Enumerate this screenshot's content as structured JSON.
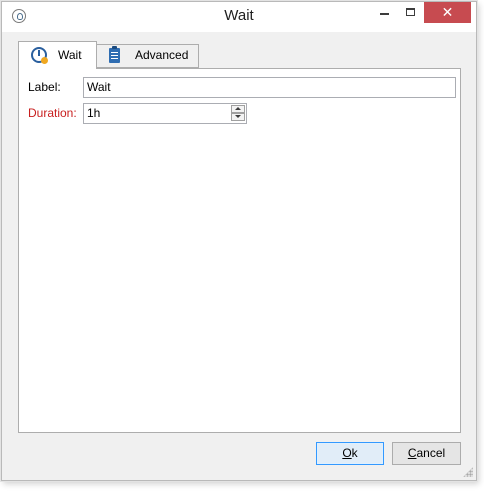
{
  "window": {
    "title": "Wait"
  },
  "titlebar": {
    "close_glyph": "✕"
  },
  "tabs": [
    {
      "label": "Wait",
      "icon": "clock-icon",
      "active": true
    },
    {
      "label": "Advanced",
      "icon": "clipboard-icon",
      "active": false
    }
  ],
  "form": {
    "label_field": {
      "label": "Label:",
      "value": "Wait"
    },
    "duration_field": {
      "label": "Duration:",
      "value": "1h"
    }
  },
  "buttons": {
    "ok_label": "Ok",
    "cancel_label": "Cancel"
  },
  "colors": {
    "required_label": "#c81e1e",
    "close_button": "#c74b50",
    "default_button_border": "#3399ff"
  }
}
